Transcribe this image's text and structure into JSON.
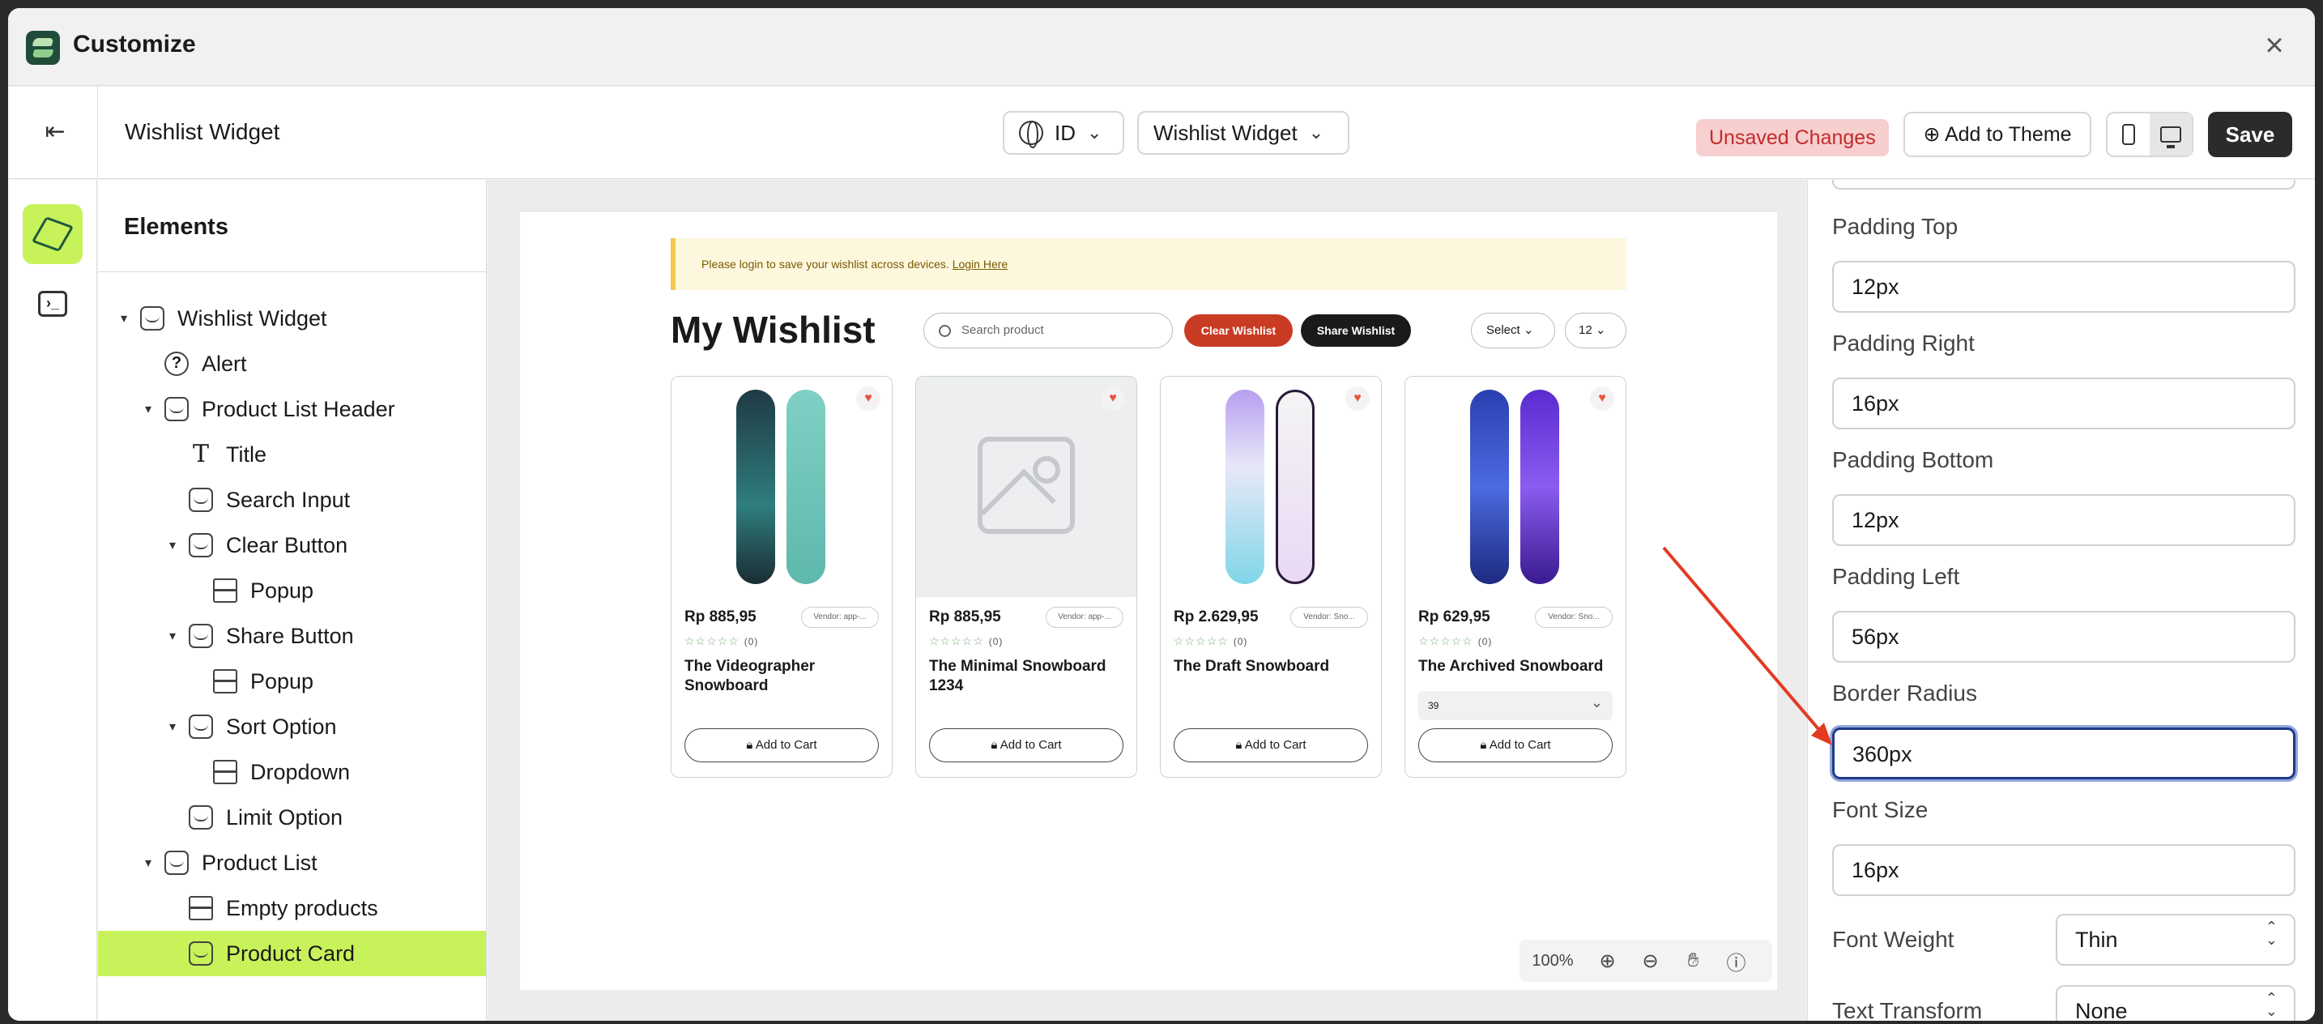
{
  "app": {
    "title": "Customize"
  },
  "toolbar": {
    "page_name": "Wishlist Widget",
    "language": "ID",
    "widget_select": "Wishlist Widget",
    "unsaved": "Unsaved Changes",
    "add_to_theme": "Add to Theme",
    "save": "Save"
  },
  "elements": {
    "title": "Elements",
    "tree": [
      {
        "label": "Wishlist Widget"
      },
      {
        "label": "Alert"
      },
      {
        "label": "Product List Header"
      },
      {
        "label": "Title"
      },
      {
        "label": "Search Input"
      },
      {
        "label": "Clear Button"
      },
      {
        "label": "Popup"
      },
      {
        "label": "Share Button"
      },
      {
        "label": "Popup"
      },
      {
        "label": "Sort Option"
      },
      {
        "label": "Dropdown"
      },
      {
        "label": "Limit Option"
      },
      {
        "label": "Product List"
      },
      {
        "label": "Empty products"
      },
      {
        "label": "Product Card"
      }
    ]
  },
  "preview": {
    "banner_text": "Please login to save your wishlist across devices.",
    "banner_link": "Login Here",
    "title": "My Wishlist",
    "search_placeholder": "Search product",
    "clear_label": "Clear Wishlist",
    "share_label": "Share Wishlist",
    "sort_label": "Select",
    "limit_label": "12",
    "cards": [
      {
        "price": "Rp 885,95",
        "vendor": "Vendor: app-...",
        "reviews": "(0)",
        "name": "The Videographer Snowboard",
        "cart": "Add to Cart"
      },
      {
        "price": "Rp 885,95",
        "vendor": "Vendor: app-...",
        "reviews": "(0)",
        "name": "The Minimal Snowboard 1234",
        "cart": "Add to Cart"
      },
      {
        "price": "Rp 2.629,95",
        "vendor": "Vendor: Sno...",
        "reviews": "(0)",
        "name": "The Draft Snowboard",
        "cart": "Add to Cart"
      },
      {
        "price": "Rp 629,95",
        "vendor": "Vendor: Sno...",
        "reviews": "(0)",
        "name": "The Archived Snowboard",
        "variant": "39",
        "cart": "Add to Cart"
      }
    ],
    "zoom": "100%"
  },
  "props": {
    "padding_top": {
      "label": "Padding Top",
      "value": "12px"
    },
    "padding_right": {
      "label": "Padding Right",
      "value": "16px"
    },
    "padding_bottom": {
      "label": "Padding Bottom",
      "value": "12px"
    },
    "padding_left": {
      "label": "Padding Left",
      "value": "56px"
    },
    "border_radius": {
      "label": "Border Radius",
      "value": "360px"
    },
    "font_size": {
      "label": "Font Size",
      "value": "16px"
    },
    "font_weight": {
      "label": "Font Weight",
      "value": "Thin"
    },
    "text_transform": {
      "label": "Text Transform",
      "value": "None"
    }
  },
  "colors": {
    "accent": "#c8f25a",
    "danger": "#c93b23",
    "focus": "#1e3a8a",
    "arrow": "#e23b22"
  }
}
